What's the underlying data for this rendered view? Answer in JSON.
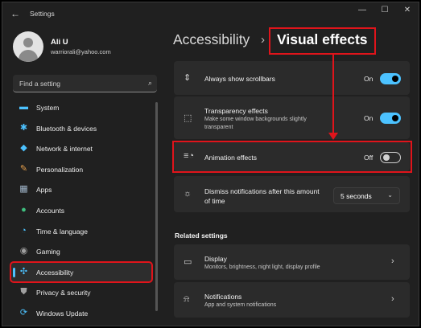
{
  "window": {
    "title": "Settings",
    "controls": [
      "—",
      "☐",
      "✕"
    ]
  },
  "user": {
    "name": "Ali U",
    "email": "warriorali@yahoo.com"
  },
  "search": {
    "placeholder": "Find a setting"
  },
  "sidebar": {
    "items": [
      {
        "label": "System",
        "icon": "system-icon",
        "glyph": "▬",
        "color": "#4cc2ff"
      },
      {
        "label": "Bluetooth & devices",
        "icon": "bluetooth-icon",
        "glyph": "✱",
        "color": "#4cc2ff"
      },
      {
        "label": "Network & internet",
        "icon": "wifi-icon",
        "glyph": "◆",
        "color": "#4cc2ff"
      },
      {
        "label": "Personalization",
        "icon": "brush-icon",
        "glyph": "✎",
        "color": "#e8a14d"
      },
      {
        "label": "Apps",
        "icon": "apps-icon",
        "glyph": "▦",
        "color": "#9fb4c8"
      },
      {
        "label": "Accounts",
        "icon": "person-icon",
        "glyph": "●",
        "color": "#3fbf7f"
      },
      {
        "label": "Time & language",
        "icon": "clock-globe-icon",
        "glyph": "◔",
        "color": "#4cc2ff"
      },
      {
        "label": "Gaming",
        "icon": "gamepad-icon",
        "glyph": "◉",
        "color": "#a0a0a0"
      },
      {
        "label": "Accessibility",
        "icon": "accessibility-icon",
        "glyph": "✣",
        "color": "#4cc2ff"
      },
      {
        "label": "Privacy & security",
        "icon": "shield-icon",
        "glyph": "⛊",
        "color": "#a0a0a0"
      },
      {
        "label": "Windows Update",
        "icon": "update-icon",
        "glyph": "⟳",
        "color": "#4cc2ff"
      }
    ],
    "active_index": 8
  },
  "header": {
    "breadcrumb_parent": "Accessibility",
    "separator": "›",
    "title": "Visual effects"
  },
  "settings": {
    "scrollbars": {
      "label": "Always show scrollbars",
      "state": "On",
      "icon": "scroll-arrows-icon"
    },
    "transparency": {
      "label": "Transparency effects",
      "description": "Make some window backgrounds slightly transparent",
      "state": "On",
      "icon": "transparency-icon"
    },
    "animation": {
      "label": "Animation effects",
      "state": "Off",
      "icon": "animation-icon"
    },
    "notifications": {
      "label": "Dismiss notifications after this amount of time",
      "value": "5 seconds",
      "icon": "brightness-icon"
    }
  },
  "related": {
    "heading": "Related settings",
    "display": {
      "label": "Display",
      "description": "Monitors, brightness, night light, display profile",
      "icon": "monitor-icon"
    },
    "notifications": {
      "label": "Notifications",
      "description": "App and system notifications",
      "icon": "bell-icon"
    }
  },
  "colors": {
    "accent": "#4cc2ff",
    "annotation": "#e0141b",
    "background": "#202020",
    "card": "#2b2b2b"
  }
}
